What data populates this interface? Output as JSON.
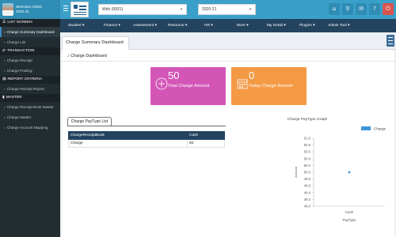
{
  "header": {
    "user_greeting": "Welcome Admin",
    "user_year": "2020-21",
    "web_select": "Web (9931)",
    "year_select": "2020-21",
    "icons": [
      {
        "name": "home-icon",
        "glyph": "⌂",
        "color": "#2f8cb5"
      },
      {
        "name": "search-icon",
        "glyph": "⚲",
        "color": "#2f8cb5"
      },
      {
        "name": "message-icon",
        "glyph": "✉",
        "color": "#2f8cb5"
      },
      {
        "name": "help-icon",
        "glyph": "?",
        "color": "#2f8cb5"
      },
      {
        "name": "power-icon",
        "glyph": "⏻",
        "color": "#d9534f"
      }
    ]
  },
  "nav": [
    {
      "label": "Student ▾"
    },
    {
      "label": "Finance ▾"
    },
    {
      "label": "Assessment ▾"
    },
    {
      "label": "Resource ▾"
    },
    {
      "label": "HR ▾"
    },
    {
      "label": "More ▾"
    },
    {
      "label": "My Detail ▾"
    },
    {
      "label": "Plugins ▾"
    },
    {
      "label": "Admin Tool ▾"
    }
  ],
  "sidebar": {
    "sections": [
      {
        "title": "LIST SCREEN",
        "icon": "☰",
        "items": [
          "Charge Summary Dashboard",
          "Charge List"
        ]
      },
      {
        "title": "TRANSACTION",
        "icon": "⇄",
        "items": [
          "Charge Receipt",
          "Charge Posting"
        ]
      },
      {
        "title": "REPORT CRITERIA",
        "icon": "▤",
        "items": [
          "Charge Receipt Report"
        ]
      },
      {
        "title": "MASTER",
        "icon": "▮",
        "items": [
          "Charge Receipt Book Master",
          "Charge Master",
          "Charge Account Mapping"
        ]
      }
    ],
    "active_item": "Charge Summary Dashboard"
  },
  "tab": {
    "label": "Charge Summary Dashboard"
  },
  "panel": {
    "title": "Charge Dashboard",
    "title_icon": "♪"
  },
  "cards": [
    {
      "value": "50",
      "label": "Total Charge Amount",
      "color": "#d356b7",
      "icon": "⊕"
    },
    {
      "value": "0",
      "label": "Today Charge Amount",
      "color": "#f49a45",
      "icon": "▦"
    }
  ],
  "paytype": {
    "tab_label": "Charge PayType List",
    "columns": [
      "ChargeReceiptBook",
      "Cash"
    ],
    "rows": [
      [
        "Charge",
        "50"
      ]
    ]
  },
  "chart_data": {
    "type": "scatter",
    "title": "Charge PayType Graph",
    "xlabel": "PayType",
    "ylabel": "Amount",
    "categories": [
      "Cash"
    ],
    "series": [
      {
        "name": "Charge",
        "values": [
          50
        ],
        "color": "#3c96dc"
      }
    ],
    "ylim": [
      49,
      51
    ],
    "yticks": [
      "51.0",
      "50.8",
      "50.6",
      "50.4",
      "50.2",
      "50.0",
      "49.8",
      "49.6",
      "49.4",
      "49.2",
      "49.0"
    ],
    "legend": "top"
  }
}
